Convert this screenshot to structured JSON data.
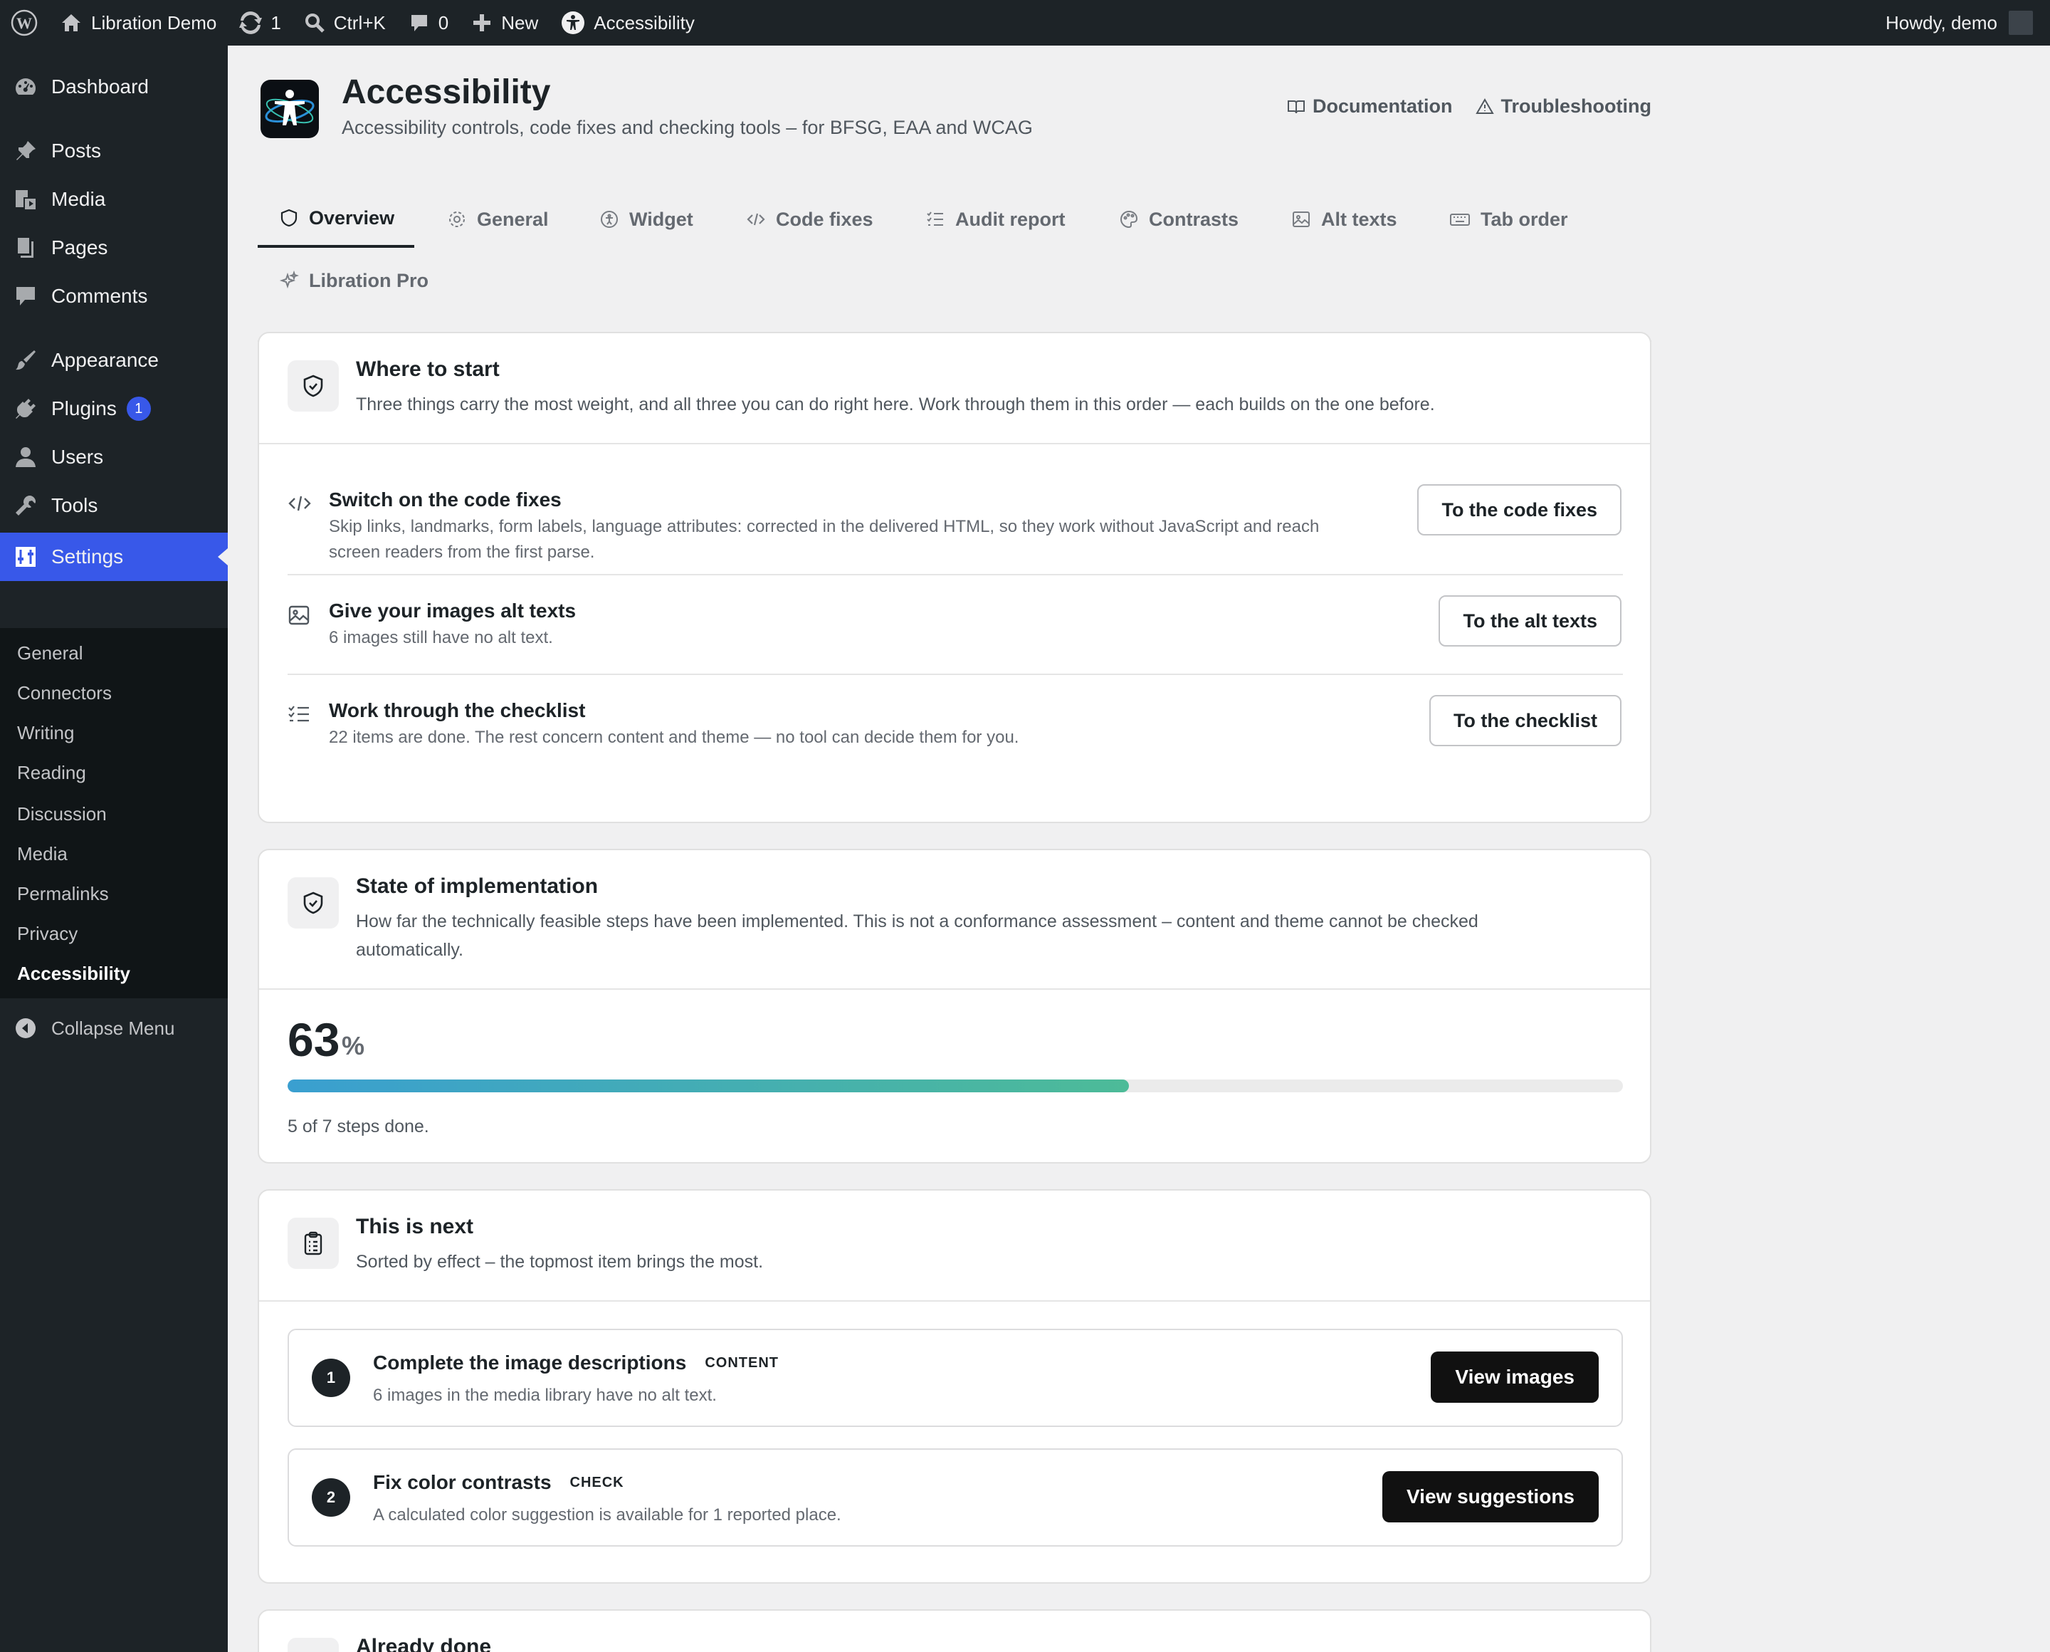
{
  "adminbar": {
    "site_name": "Libration Demo",
    "updates_count": "1",
    "search_shortcut": "Ctrl+K",
    "comments_count": "0",
    "new_label": "New",
    "accessibility_label": "Accessibility",
    "greeting": "Howdy, demo"
  },
  "sidebar": {
    "dashboard": "Dashboard",
    "posts": "Posts",
    "media": "Media",
    "pages": "Pages",
    "comments": "Comments",
    "appearance": "Appearance",
    "plugins": "Plugins",
    "plugins_badge": "1",
    "users": "Users",
    "tools": "Tools",
    "settings": "Settings",
    "submenu": [
      "General",
      "Connectors",
      "Writing",
      "Reading",
      "Discussion",
      "Media",
      "Permalinks",
      "Privacy",
      "Accessibility"
    ],
    "collapse": "Collapse Menu"
  },
  "header": {
    "title": "Accessibility",
    "subtitle": "Accessibility controls, code fixes and checking tools – for BFSG, EAA and WCAG",
    "documentation": "Documentation",
    "troubleshooting": "Troubleshooting"
  },
  "tabs": {
    "overview": "Overview",
    "general": "General",
    "widget": "Widget",
    "code_fixes": "Code fixes",
    "audit_report": "Audit report",
    "contrasts": "Contrasts",
    "alt_texts": "Alt texts",
    "tab_order": "Tab order",
    "libration_pro": "Libration Pro"
  },
  "start": {
    "title": "Where to start",
    "desc": "Three things carry the most weight, and all three you can do right here. Work through them in this order — each builds on the one before.",
    "items": [
      {
        "title": "Switch on the code fixes",
        "desc": "Skip links, landmarks, form labels, language attributes: corrected in the delivered HTML, so they work without JavaScript and reach screen readers from the first parse.",
        "button": "To the code fixes"
      },
      {
        "title": "Give your images alt texts",
        "desc": "6 images still have no alt text.",
        "button": "To the alt texts"
      },
      {
        "title": "Work through the checklist",
        "desc": "22 items are done. The rest concern content and theme — no tool can decide them for you.",
        "button": "To the checklist"
      }
    ]
  },
  "state": {
    "title": "State of implementation",
    "desc": "How far the technically feasible steps have been implemented. This is not a conformance assessment – content and theme cannot be checked automatically.",
    "percent": "63",
    "percent_sign": "%",
    "progress_fraction": 0.63,
    "steps_text": "5 of 7 steps done."
  },
  "next": {
    "title": "This is next",
    "desc": "Sorted by effect – the topmost item brings the most.",
    "items": [
      {
        "num": "1",
        "title": "Complete the image descriptions",
        "tag": "CONTENT",
        "desc": "6 images in the media library have no alt text.",
        "button": "View images"
      },
      {
        "num": "2",
        "title": "Fix color contrasts",
        "tag": "CHECK",
        "desc": "A calculated color suggestion is available for 1 reported place.",
        "button": "View suggestions"
      }
    ]
  },
  "done": {
    "title": "Already done"
  },
  "colors": {
    "accent": "#3858e9",
    "adminbar": "#1d2327",
    "progress_start": "#3a9fd0",
    "progress_end": "#4dbb98"
  }
}
